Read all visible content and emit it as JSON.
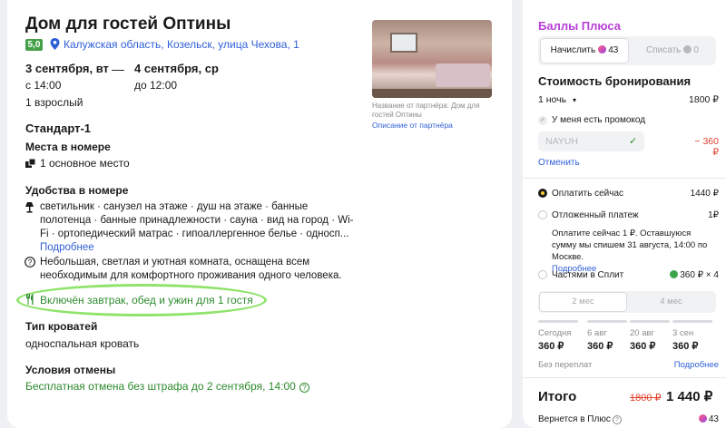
{
  "hotel": {
    "title": "Дом для гостей Оптины",
    "rating": "5,0",
    "address": "Калужская область, Козельск, улица Чехова, 1"
  },
  "stay": {
    "checkin_date": "3 сентября, вт",
    "checkin_time": "с 14:00",
    "checkout_date": "4 сентября, ср",
    "checkout_time": "до 12:00",
    "separator": "—",
    "guests": "1 взрослый"
  },
  "room": {
    "name": "Стандарт-1",
    "places_heading": "Места в номере",
    "places_value": "1 основное место",
    "amenities_heading": "Удобства в номере",
    "amenities_text": "светильник · санузел на этаже · душ на этаже · банные полотенца · банные принадлежности · сауна · вид на город · Wi-Fi · ортопедический матрас · гипоаллергенное белье · односп...",
    "amenities_more": "Подробнее",
    "description": "Небольшая, светлая и уютная комната, оснащена всем необходимым для комфортного проживания одного человека.",
    "meals": "Включён завтрак, обед и ужин для 1 гостя",
    "bed_heading": "Тип кроватей",
    "bed_value": "односпальная кровать",
    "cancel_heading": "Условия отмены",
    "cancel_value": "Бесплатная отмена без штрафа до 2 сентября, 14:00"
  },
  "photo": {
    "caption": "Название от партнёра: Дом для гостей Оптины",
    "partner_link": "Описание от партнёра"
  },
  "plus": {
    "title": "Баллы Плюса",
    "accrue_label": "Начислить",
    "accrue_value": "43",
    "spend_label": "Списать",
    "spend_value": "0"
  },
  "booking": {
    "heading": "Стоимость бронирования",
    "nights": "1 ночь",
    "nights_price": "1800 ₽",
    "promo_label": "У меня есть промокод",
    "promo_code": "NAYUH",
    "promo_discount": "− 360 ₽",
    "cancel_link": "Отменить",
    "pay_now_label": "Оплатить сейчас",
    "pay_now_price": "1440 ₽",
    "deferred_label": "Отложенный платеж",
    "deferred_price": "1₽",
    "deferred_info": "Оплатите сейчас 1 ₽. Оставшуюся сумму мы спишем 31 августа, 14:00 по Москве.",
    "deferred_more": "Подробнее",
    "split_label": "Частями в Сплит",
    "split_price": "360 ₽ × 4",
    "split_tab_2": "2 мес",
    "split_tab_4": "4 мес",
    "schedule": [
      {
        "date": "Сегодня",
        "amount": "360 ₽"
      },
      {
        "date": "6 авг",
        "amount": "360 ₽"
      },
      {
        "date": "20 авг",
        "amount": "360 ₽"
      },
      {
        "date": "3 сен",
        "amount": "360 ₽"
      }
    ],
    "no_overpay": "Без переплат",
    "split_more": "Подробнее",
    "total_label": "Итого",
    "total_old": "1800 ₽",
    "total_new": "1 440 ₽",
    "cashback_label": "Вернется в Плюс",
    "cashback_value": "43"
  },
  "colors": {
    "accent_link": "#2f5fd6",
    "green": "#2e8b2e",
    "plus_purple": "#b83fd6",
    "highlight_oval": "#8fe36a"
  }
}
